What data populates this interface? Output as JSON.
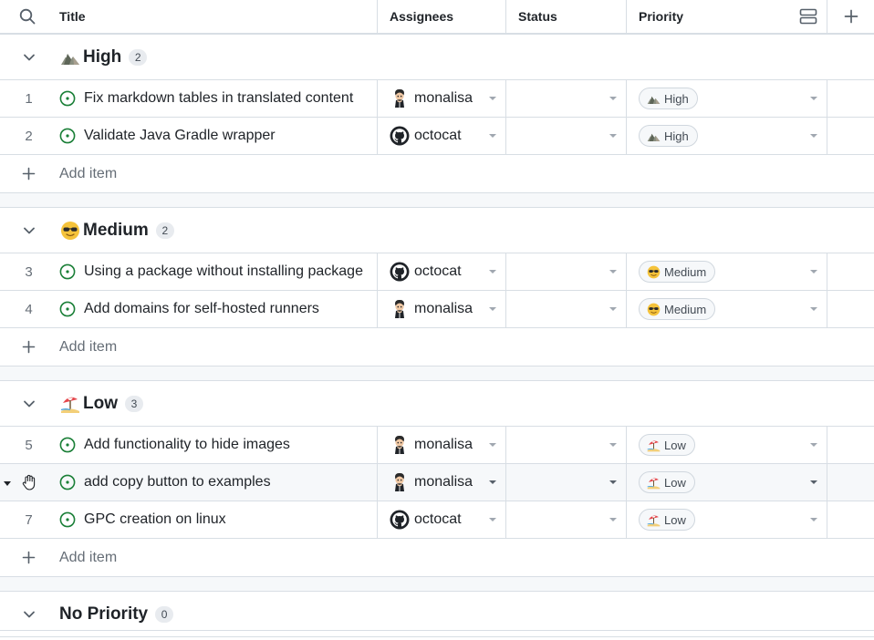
{
  "header": {
    "title": "Title",
    "assignees": "Assignees",
    "status": "Status",
    "priority": "Priority"
  },
  "groups": [
    {
      "name": "High",
      "count": "2",
      "emoji": "mountain",
      "add_label": "Add item",
      "rows": [
        {
          "num": "1",
          "title": "Fix markdown tables in translated content",
          "assignee": "monalisa",
          "avatar": "monalisa",
          "priority": "High"
        },
        {
          "num": "2",
          "title": "Validate Java Gradle wrapper",
          "assignee": "octocat",
          "avatar": "octocat",
          "priority": "High"
        }
      ]
    },
    {
      "name": "Medium",
      "count": "2",
      "emoji": "sunglasses",
      "add_label": "Add item",
      "rows": [
        {
          "num": "3",
          "title": "Using a package without installing package",
          "assignee": "octocat",
          "avatar": "octocat",
          "priority": "Medium"
        },
        {
          "num": "4",
          "title": "Add domains for self-hosted runners",
          "assignee": "monalisa",
          "avatar": "monalisa",
          "priority": "Medium"
        }
      ]
    },
    {
      "name": "Low",
      "count": "3",
      "emoji": "beach",
      "add_label": "Add item",
      "rows": [
        {
          "num": "5",
          "title": "Add functionality to hide images",
          "assignee": "monalisa",
          "avatar": "monalisa",
          "priority": "Low"
        },
        {
          "num": "",
          "title": "add copy button to examples",
          "assignee": "monalisa",
          "avatar": "monalisa",
          "priority": "Low",
          "hover": true
        },
        {
          "num": "7",
          "title": "GPC creation on linux",
          "assignee": "octocat",
          "avatar": "octocat",
          "priority": "Low"
        }
      ]
    },
    {
      "name": "No Priority",
      "count": "0",
      "emoji": "",
      "rows": []
    }
  ],
  "colors": {
    "open_issue": "#1a7f37",
    "border": "#d8dee4",
    "muted_text": "#656d76"
  }
}
